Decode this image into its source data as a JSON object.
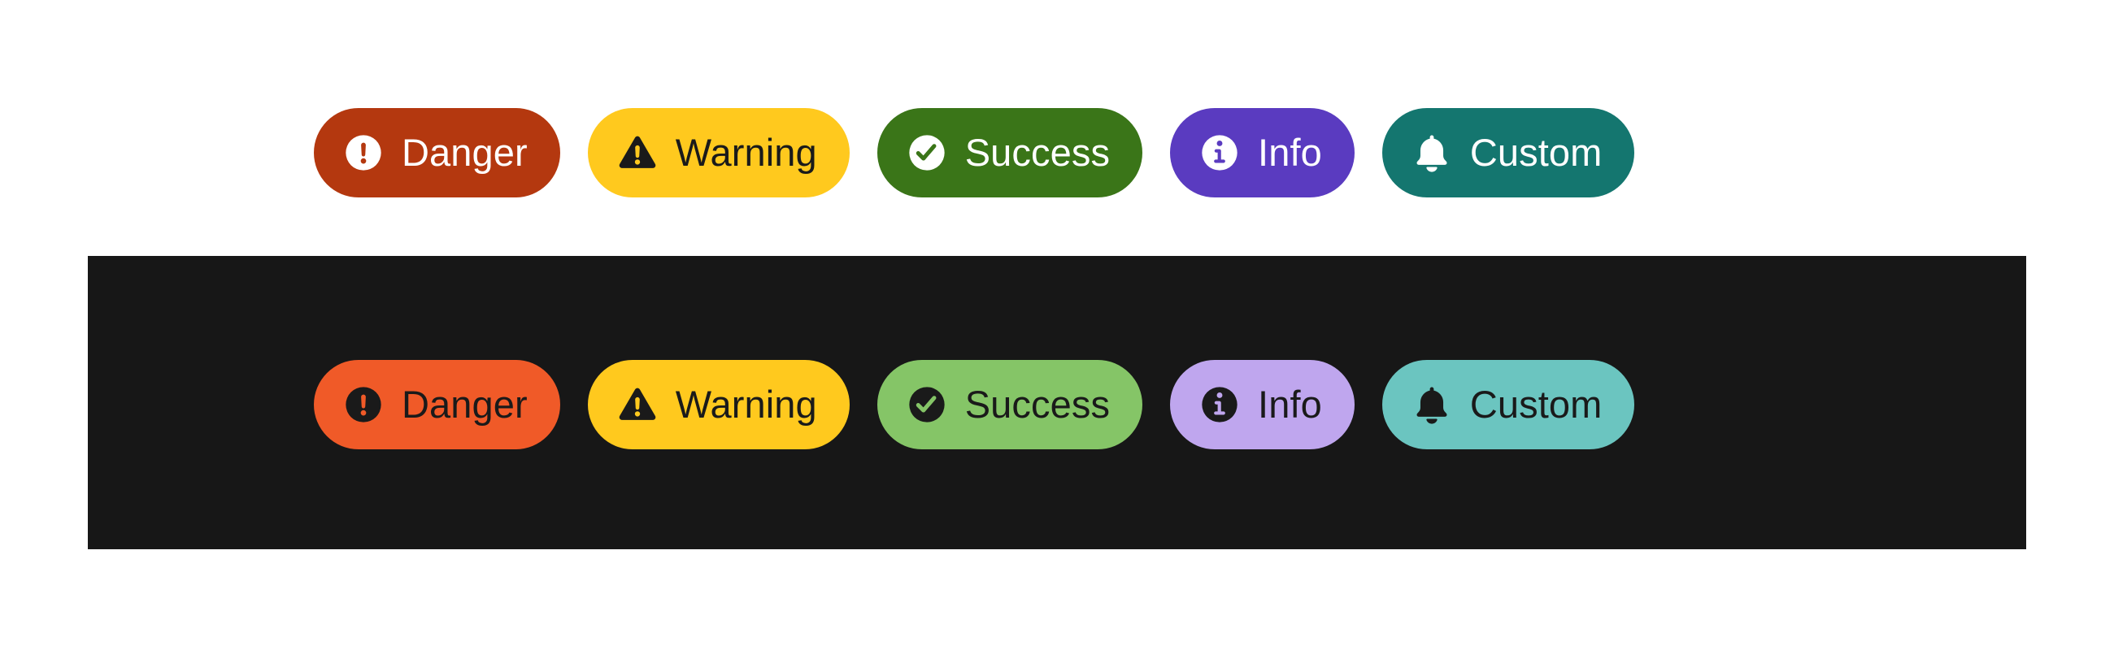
{
  "page": {
    "background": "#ffffff",
    "dark_panel_background": "#171717"
  },
  "rows": [
    {
      "name": "light-theme-row",
      "theme": "light",
      "surface": "#ffffff",
      "badges": [
        {
          "id": "danger",
          "label": "Danger",
          "icon": "circle-exclamation-icon",
          "background": "#B4380F",
          "foreground": "#FFFFFF"
        },
        {
          "id": "warning",
          "label": "Warning",
          "icon": "triangle-exclamation-icon",
          "background": "#FFC91E",
          "foreground": "#1A1A1A"
        },
        {
          "id": "success",
          "label": "Success",
          "icon": "circle-check-icon",
          "background": "#3A7518",
          "foreground": "#FFFFFF"
        },
        {
          "id": "info",
          "label": "Info",
          "icon": "circle-info-icon",
          "background": "#5A3BC0",
          "foreground": "#FFFFFF"
        },
        {
          "id": "custom",
          "label": "Custom",
          "icon": "bell-icon",
          "background": "#14766F",
          "foreground": "#FFFFFF"
        }
      ]
    },
    {
      "name": "dark-theme-row",
      "theme": "dark",
      "surface": "#171717",
      "badges": [
        {
          "id": "danger",
          "label": "Danger",
          "icon": "circle-exclamation-icon",
          "background": "#F05A28",
          "foreground": "#1A1A1A"
        },
        {
          "id": "warning",
          "label": "Warning",
          "icon": "triangle-exclamation-icon",
          "background": "#FFC91E",
          "foreground": "#1A1A1A"
        },
        {
          "id": "success",
          "label": "Success",
          "icon": "circle-check-icon",
          "background": "#85C567",
          "foreground": "#1A1A1A"
        },
        {
          "id": "info",
          "label": "Info",
          "icon": "circle-info-icon",
          "background": "#BFA6EE",
          "foreground": "#1A1A1A"
        },
        {
          "id": "custom",
          "label": "Custom",
          "icon": "bell-icon",
          "background": "#6BC5C0",
          "foreground": "#1A1A1A"
        }
      ]
    }
  ]
}
